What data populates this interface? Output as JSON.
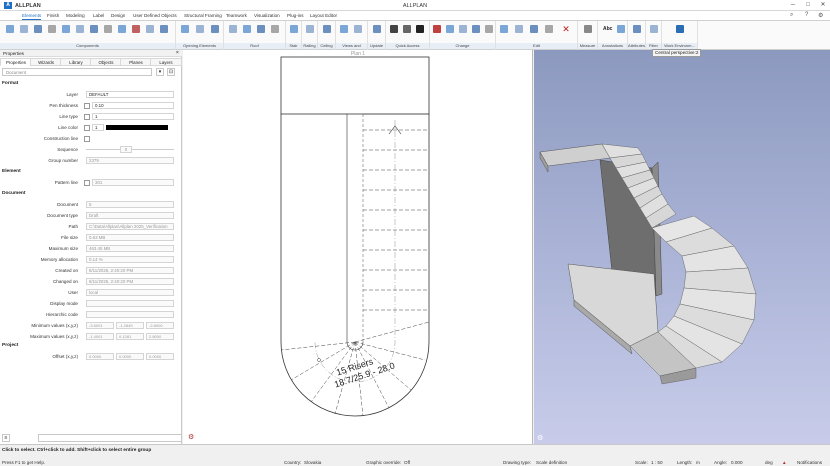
{
  "app": {
    "name": "ALLPLAN",
    "badge": "A",
    "title": "ALLPLAN"
  },
  "menu": [
    "Elements",
    "Finish",
    "Modeling",
    "Label",
    "Design",
    "User Defined Objects",
    "Structural Framing",
    "Teamwork",
    "Visualization",
    "Plug-ins",
    "Layout Editor"
  ],
  "ribbon_groups": [
    "Components",
    "Opening Elements",
    "Roof",
    "Stair",
    "Railing",
    "Ceiling",
    "Views and Secti...",
    "Update",
    "Quick Access",
    "Change",
    "Edit",
    "Measure",
    "Annotations",
    "Attributes",
    "Filter",
    "Work Environm..."
  ],
  "ribbon_small": {
    "abc": "Abc"
  },
  "left_panel": {
    "title": "Properties",
    "close": "×",
    "tabs": [
      "Properties",
      "Wizards",
      "Library",
      "Objects",
      "Planes",
      "Layers"
    ],
    "combo_value": "Document",
    "sections": {
      "format": "Format",
      "element": "Element",
      "document": "Document",
      "project": "Project"
    },
    "format": {
      "layer_label": "Layer",
      "layer_value": "DEFAULT",
      "pen_label": "Pen thickness",
      "pen_value": "0.10",
      "line_type_label": "Line type",
      "line_type_value": "1",
      "line_color_label": "Line color",
      "line_color_value": "1",
      "construction_label": "Construction line",
      "sequence_label": "Sequence",
      "sequence_value": "0",
      "group_label": "Group number",
      "group_value": "2379"
    },
    "element": {
      "pattern_label": "Pattern line",
      "pattern_value": "301"
    },
    "document": {
      "doc_label": "Document",
      "doc_value": "5",
      "type_label": "Document type",
      "type_value": "Draft",
      "path_label": "Path",
      "path_value": "C:\\Data\\Allplan\\Allplan 2025_Verification",
      "filesize_label": "File size",
      "filesize_value": "0.63 MB",
      "maxsize_label": "Maximum size",
      "maxsize_value": "463.45 MB",
      "memory_label": "Memory allocation",
      "memory_value": "0.14 %",
      "created_label": "Created on",
      "created_value": "8/11/2025, 2:40:20 PM",
      "changed_label": "Changed on",
      "changed_value": "8/11/2025, 2:40:20 PM",
      "user_label": "User",
      "user_value": "local",
      "display_label": "Display mode",
      "hier_label": "Hierarchic code",
      "min_label": "Minimum values (x,y,z)",
      "min_values": [
        "-3.6001",
        "-1.2849",
        "-2.8000"
      ],
      "max_label": "Maximum values (x,y,z)",
      "max_values": [
        "-1.4001",
        "0.1281",
        "2.8000"
      ]
    },
    "project": {
      "offset_label": "Offset (x,y,z)",
      "offset_values": [
        "0.0000",
        "0.0000",
        "0.0000"
      ]
    }
  },
  "plan_view": {
    "label": "Plan 1",
    "stair_text_1": "15 Risers",
    "stair_text_2": "18.7/25.9 - 28.0"
  },
  "view_3d": {
    "tooltip": "Central perspective:2"
  },
  "status": {
    "hint": "Click to select. Ctrl+click to add. Shift+click to select entire group",
    "help": "Press F1 to get Help.",
    "country_label": "Country:",
    "country_value": "Slovakia",
    "graphic_label": "Graphic override:",
    "graphic_value": "Off",
    "drawing_label": "Drawing type:",
    "drawing_value": "Scale definition",
    "scale_label": "Scale:",
    "scale_value": "1 : 50",
    "length_label": "Length:",
    "length_value": "m",
    "angle_label": "Angle:",
    "angle_value": "0.000",
    "deg_value": "deg",
    "notifications": "Notifications"
  },
  "colors": {
    "accent": "#1f6fc5",
    "sky_top": "#8c99bf",
    "sky_bottom": "#c8ccea"
  }
}
